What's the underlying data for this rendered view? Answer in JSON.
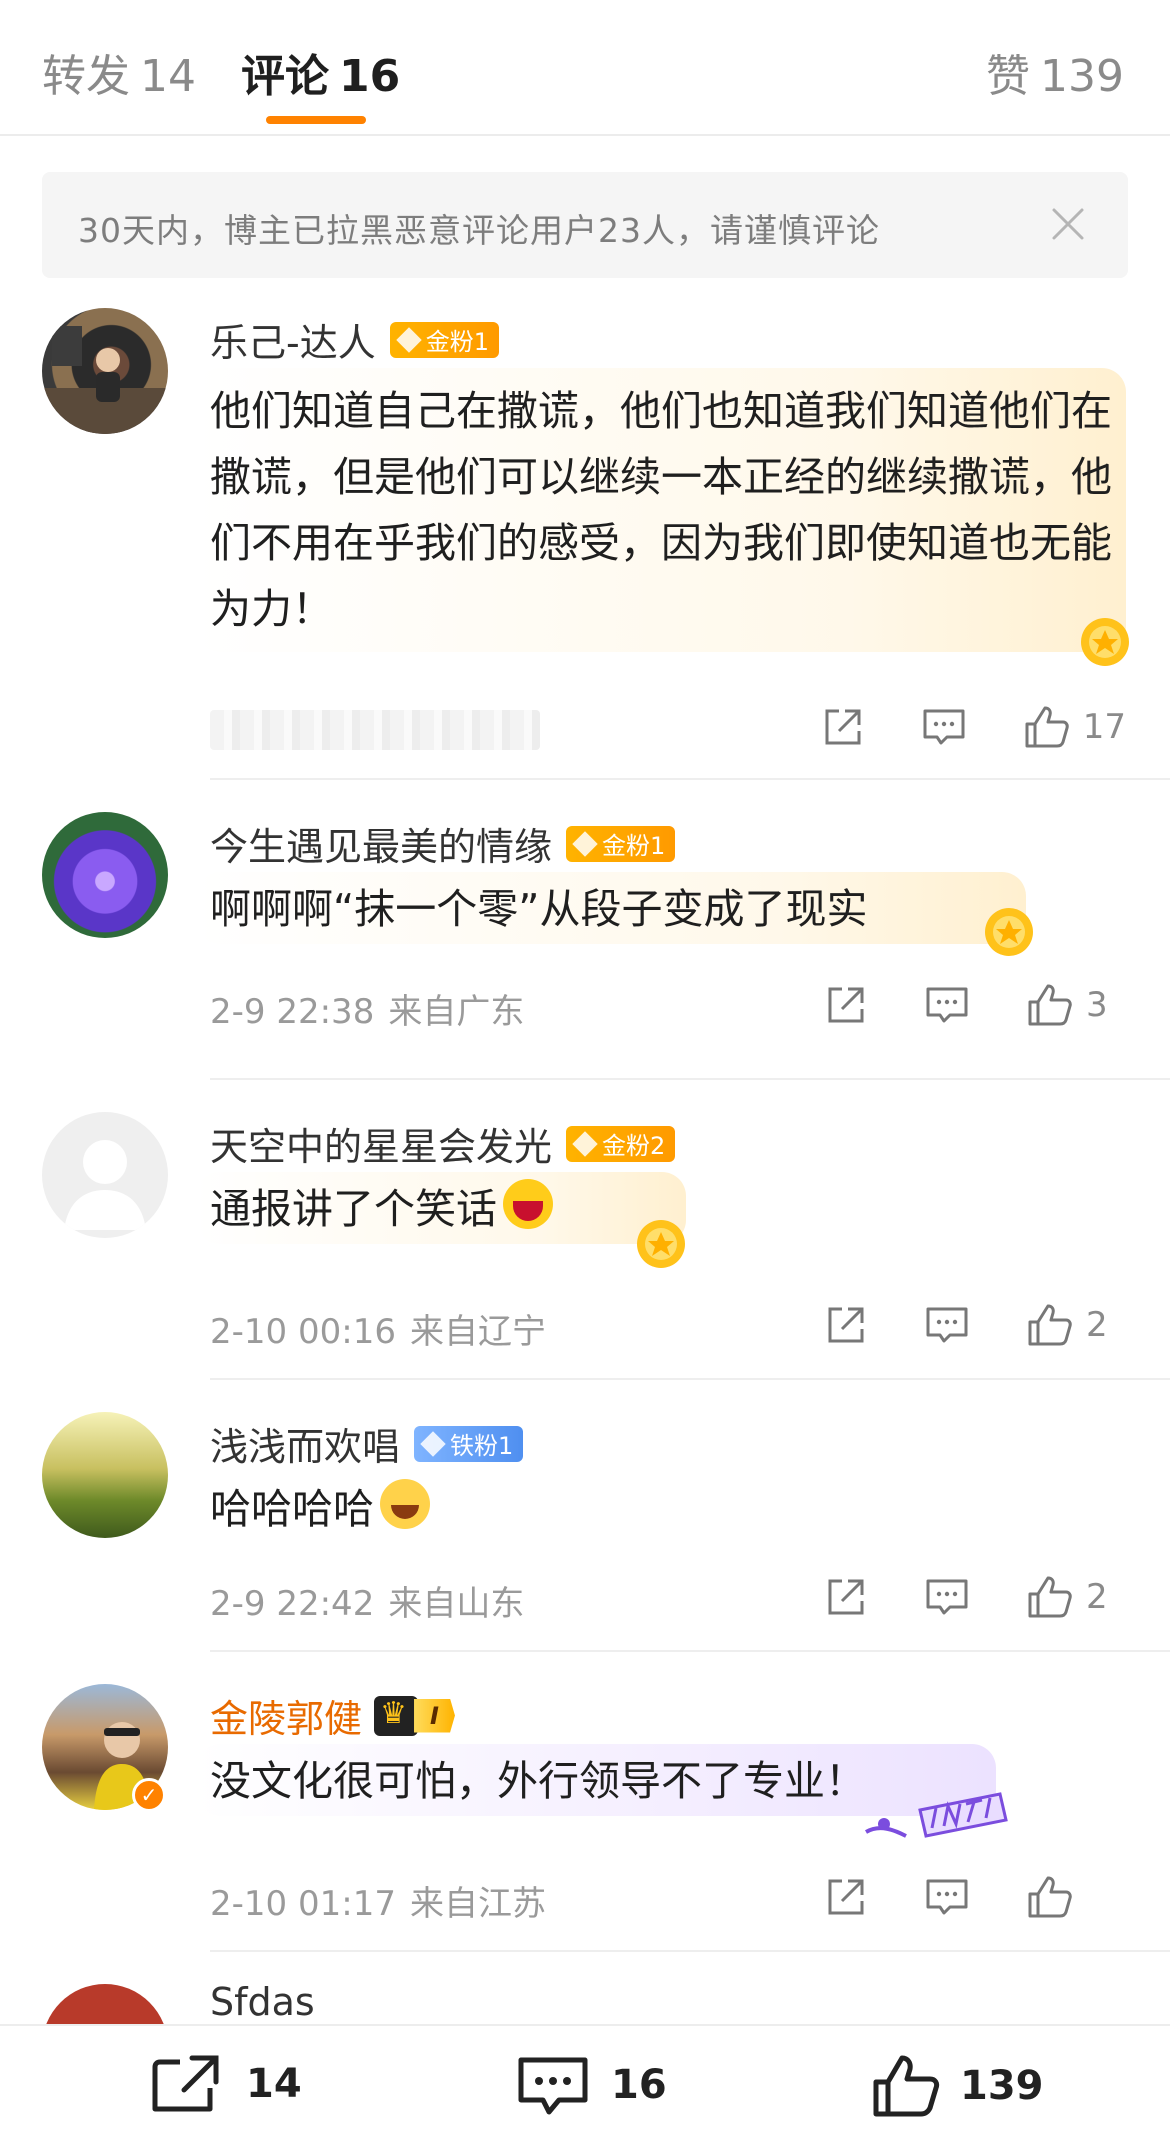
{
  "tabs": {
    "repost_label": "转发",
    "repost_count": "14",
    "comments_label": "评论",
    "comments_count": "16",
    "likes_label": "赞",
    "likes_count": "139"
  },
  "notice": {
    "text": "30天内，博主已拉黑恶意评论用户23人，请谨慎评论"
  },
  "comments": [
    {
      "user": "乐己-达人",
      "badge": "金粉1",
      "text": "他们知道自己在撒谎，他们也知道我们知道他们在撒谎，但是他们可以继续一本正经的继续撒谎，他们不用在乎我们的感受，因为我们即使知道也无能为力！",
      "time": "",
      "location": "",
      "likes": "17"
    },
    {
      "user": "今生遇见最美的情缘",
      "badge": "金粉1",
      "text": "啊啊啊“抹一个零”从段子变成了现实",
      "time": "2-9 22:38",
      "location": "来自广东",
      "likes": "3"
    },
    {
      "user": "天空中的星星会发光",
      "badge": "金粉2",
      "text": "通报讲了个笑话",
      "time": "2-10 00:16",
      "location": "来自辽宁",
      "likes": "2"
    },
    {
      "user": "浅浅而欢唱",
      "badge": "铁粉1",
      "text": "哈哈哈哈",
      "time": "2-9 22:42",
      "location": "来自山东",
      "likes": "2"
    },
    {
      "user": "金陵郭健",
      "badge": "I",
      "text": "没文化很可怕，外行领导不了专业！",
      "time": "2-10 01:17",
      "location": "来自江苏",
      "likes": ""
    },
    {
      "user": "Sfdas"
    }
  ],
  "bottom_bar": {
    "repost_count": "14",
    "comment_count": "16",
    "like_count": "139"
  },
  "colors": {
    "accent": "#ff8200",
    "vip_name": "#e86a00",
    "meta_gray": "#9a9a9a"
  }
}
